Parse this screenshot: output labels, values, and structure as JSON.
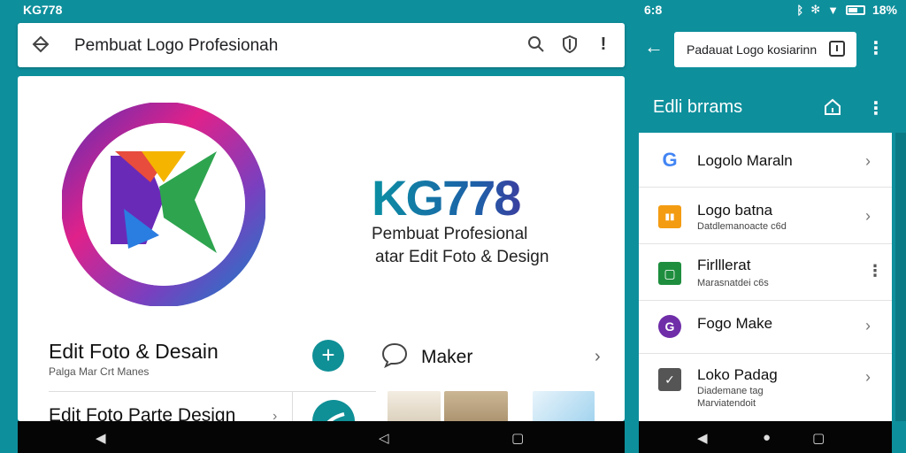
{
  "status_bar": {
    "left_text": "KG778",
    "mid_text": "6:8",
    "battery": "18%",
    "icons": [
      "bluetooth-icon",
      "settings-icon",
      "wifi-icon",
      "battery-icon"
    ]
  },
  "left": {
    "search_title": "Pembuat Logo Profesionah",
    "brand_name": "KG778",
    "brand_line1": "Pembuat Profesional",
    "brand_line2": "atar Edit Foto & Design",
    "feature1_title": "Edit Foto & Desain",
    "feature1_sub": "Palga Mar Crt Manes",
    "fab_label": "+",
    "feature2_title": "Maker",
    "feature3_title": "Edit Foto Parte Design"
  },
  "right": {
    "search_title": "Padauat Logo kosiarinn",
    "sub_title": "Edli brrams",
    "items": [
      {
        "title": "Logolo Maraln",
        "sub": "",
        "icon": "G",
        "color": "#ffffff"
      },
      {
        "title": "Logo batna",
        "sub": "Datdlemanoacte c6d",
        "icon": "▮▮",
        "color": "#f39c12"
      },
      {
        "title": "Firlllerat",
        "sub": "Marasnatdei c6s",
        "icon": "▢",
        "color": "#1e8e3e"
      },
      {
        "title": "Fogo Make",
        "sub": "",
        "icon": "G",
        "color": "#6f2da8"
      },
      {
        "title": "Loko Padag",
        "sub": "Diademane tag",
        "sub2": "Marviatendoit",
        "icon": "✓",
        "color": "#555555"
      }
    ]
  },
  "colors": {
    "background": "#0e8f9c",
    "accent": "#0f8f96"
  }
}
